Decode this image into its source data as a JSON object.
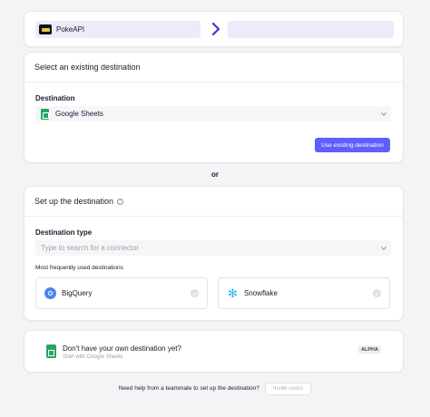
{
  "connection": {
    "source_name": "PokeAPI",
    "source_icon": "pokeapi-logo",
    "arrow_icon": "chevron-right-icon",
    "destination_name": ""
  },
  "existing": {
    "title": "Select an existing destination",
    "destination_label": "Destination",
    "selected_value": "Google Sheets",
    "selected_icon": "google-sheets-icon",
    "use_button": "Use existing destination"
  },
  "separator": "or",
  "setup": {
    "title": "Set up the destination",
    "destination_type_label": "Destination type",
    "search_placeholder": "Type to search for a connector",
    "frequent_label": "Most frequently used destinations",
    "frequent": [
      {
        "name": "BigQuery",
        "icon": "bigquery-icon"
      },
      {
        "name": "Snowflake",
        "icon": "snowflake-icon"
      }
    ]
  },
  "own_destination": {
    "title": "Don't have your own destination yet?",
    "subtitle": "Start with Google Sheets",
    "badge": "ALPHA"
  },
  "help": {
    "text": "Need help from a teammate to set up the destination?",
    "invite_button": "Invite users"
  },
  "colors": {
    "accent": "#615eff",
    "sheets_green": "#23a566",
    "header_bg": "#ebebfa"
  }
}
